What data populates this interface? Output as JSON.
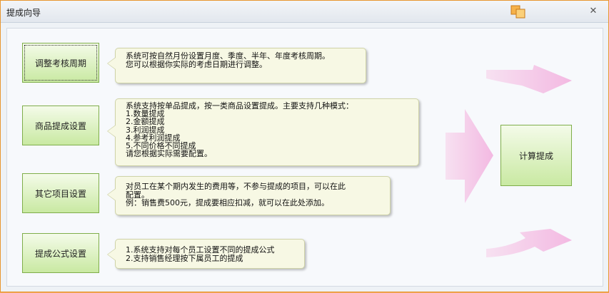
{
  "window": {
    "title": "提成向导",
    "icons": {
      "restore": "restore-icon",
      "close": "close-icon"
    },
    "close_glyph": "✕"
  },
  "steps": [
    {
      "label": "调整考核周期",
      "tip": [
        "系统可按自然月份设置月度、季度、半年、年度考核周期。",
        "您可以根据你实际的考虑日期进行调整。"
      ]
    },
    {
      "label": "商品提成设置",
      "tip": [
        "系统支持按单品提成，按一类商品设置提成。主要支持几种模式：",
        "1.数量提成",
        "2.金额提成",
        "3.利润提成",
        "4.参考利润提成",
        "5.不同价格不同提成",
        "请您根据实际需要配置。"
      ]
    },
    {
      "label": "其它项目设置",
      "tip": [
        "对员工在某个期内发生的费用等，不参与提成的项目，可以在此",
        "配置。",
        "例：销售费500元，提成要相应扣减，就可以在此处添加。"
      ]
    },
    {
      "label": "提成公式设置",
      "tip": [
        "1.系统支持对每个员工设置不同的提成公式",
        "2.支持销售经理按下属员工的提成"
      ]
    }
  ],
  "calc_button": {
    "label": "计算提成"
  },
  "colors": {
    "accent_border": "#e8962f",
    "button_green": "#c9e9a2",
    "arrow_pink": "#f5c6e6"
  }
}
